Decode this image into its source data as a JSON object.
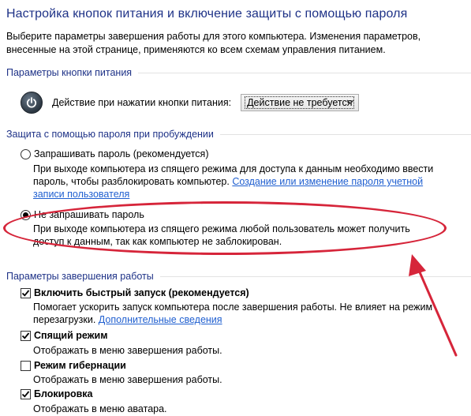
{
  "page": {
    "title": "Настройка кнопок питания и включение защиты с помощью пароля",
    "description": "Выберите параметры завершения работы для этого компьютера. Изменения параметров, внесенные на этой странице, применяются ко всем схемам управления питанием."
  },
  "power_buttons": {
    "section_title": "Параметры кнопки питания",
    "action_label": "Действие при нажатии кнопки питания:",
    "action_value": "Действие не требуется"
  },
  "password_protection": {
    "section_title": "Защита с помощью пароля при пробуждении",
    "options": [
      {
        "label": "Запрашивать пароль (рекомендуется)",
        "description": "При выходе компьютера из спящего режима для доступа к данным необходимо ввести пароль, чтобы разблокировать компьютер.",
        "link": "Создание или изменение пароля учетной записи пользователя",
        "selected": false
      },
      {
        "label": "Не запрашивать пароль",
        "description": "При выходе компьютера из спящего режима любой пользователь может получить доступ к данным, так как компьютер не заблокирован.",
        "selected": true
      }
    ]
  },
  "shutdown": {
    "section_title": "Параметры завершения работы",
    "options": [
      {
        "label": "Включить быстрый запуск (рекомендуется)",
        "description": "Помогает ускорить запуск компьютера после завершения работы. Не влияет на режим перезагрузки.",
        "link": "Дополнительные сведения",
        "checked": true
      },
      {
        "label": "Спящий режим",
        "description": "Отображать в меню завершения работы.",
        "checked": true
      },
      {
        "label": "Режим гибернации",
        "description": "Отображать в меню завершения работы.",
        "checked": false
      },
      {
        "label": "Блокировка",
        "description": "Отображать в меню аватара.",
        "checked": true
      }
    ]
  },
  "colors": {
    "heading": "#1e3287",
    "link": "#1f5fd0",
    "annotation": "#d6253a"
  }
}
